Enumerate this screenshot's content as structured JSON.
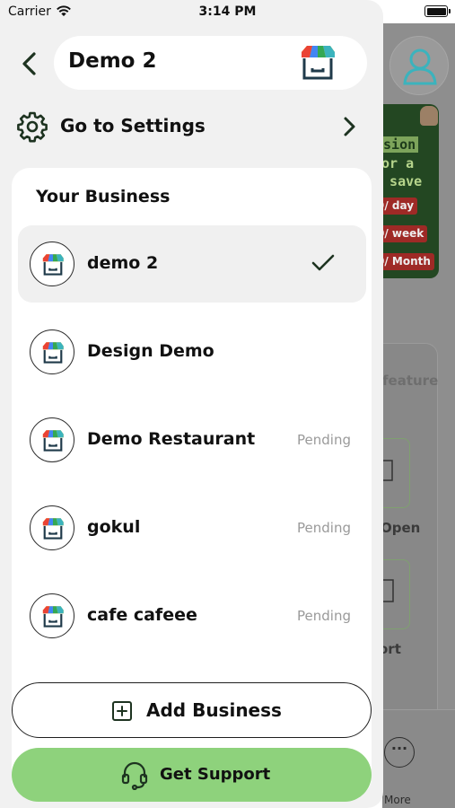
{
  "status_bar": {
    "carrier": "Carrier",
    "time": "3:14 PM"
  },
  "header": {
    "title": "Demo 2"
  },
  "settings": {
    "label": "Go to Settings"
  },
  "business": {
    "heading": "Your Business",
    "items": [
      {
        "name": "demo 2",
        "status": "",
        "selected": true
      },
      {
        "name": "Design Demo",
        "status": "",
        "selected": false
      },
      {
        "name": "Demo Restaurant",
        "status": "Pending",
        "selected": false
      },
      {
        "name": "gokul",
        "status": "Pending",
        "selected": false
      },
      {
        "name": "cafe cafeee",
        "status": "Pending",
        "selected": false
      }
    ]
  },
  "actions": {
    "add_label": "Add Business",
    "support_label": "Get Support"
  },
  "background": {
    "promo_lines": [
      "usion",
      "for a",
      "t save"
    ],
    "promo_tags": [
      "9/ day",
      "0/ week",
      "0/ Month"
    ],
    "feature_text": "feature",
    "open_text": "Open",
    "report_text": "ort",
    "more_label": "More"
  },
  "colors": {
    "accent_green": "#8ed27c",
    "promo_bg": "#234722",
    "tag_red": "#9e2a26",
    "drawer_bg": "#f1f1f1"
  }
}
